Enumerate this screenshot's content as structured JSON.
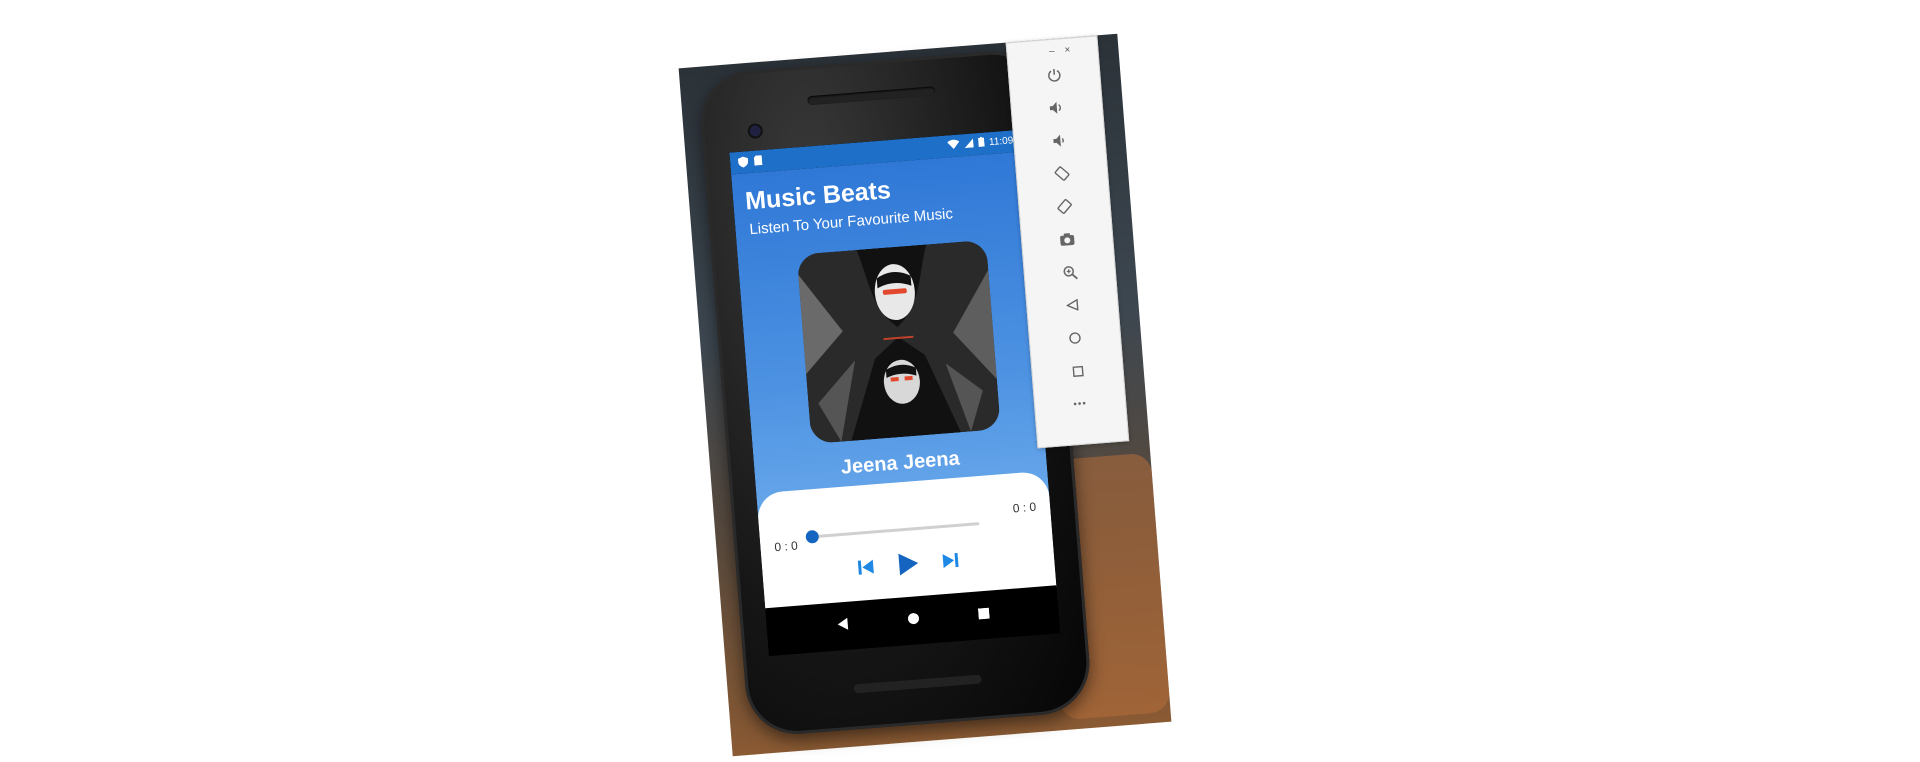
{
  "status_bar": {
    "time": "11:09"
  },
  "app": {
    "title": "Music Beats",
    "subtitle": "Listen To Your Favourite Music",
    "song_title": "Jeena Jeena"
  },
  "player": {
    "current_time": "0 : 0",
    "total_time": "0 : 0",
    "progress": 0,
    "controls": [
      "skip-previous-icon",
      "play-icon",
      "skip-next-icon"
    ],
    "accent_color": "#1565c0"
  },
  "emulator_toolbar": {
    "minimize": "–",
    "close": "×",
    "tools": [
      "power-icon",
      "volume-up-icon",
      "volume-down-icon",
      "rotate-left-icon",
      "rotate-right-icon",
      "screenshot-icon",
      "zoom-icon",
      "back-icon",
      "home-icon",
      "overview-icon",
      "more-icon"
    ],
    "more_label": "•••"
  }
}
